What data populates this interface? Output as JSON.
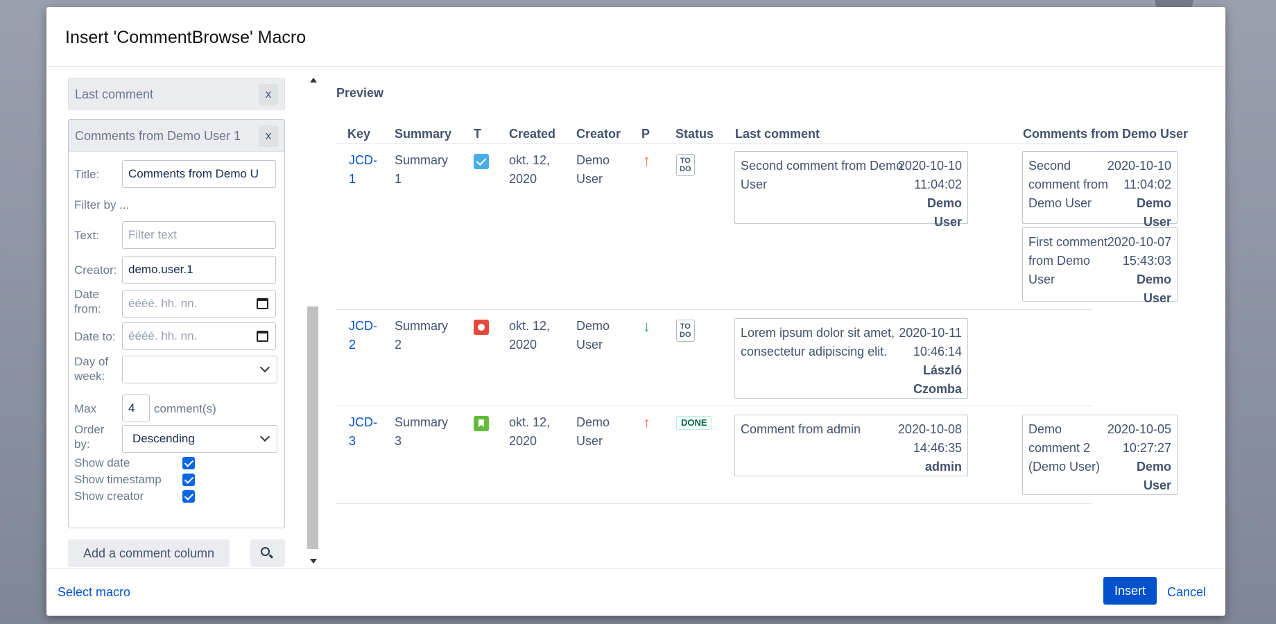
{
  "dialog": {
    "title": "Insert 'CommentBrowse' Macro",
    "footer": {
      "select_macro": "Select macro",
      "insert": "Insert",
      "cancel": "Cancel"
    }
  },
  "config": {
    "collapsed_column": {
      "title": "Last comment",
      "close": "x"
    },
    "column": {
      "title": "Comments from Demo User 1",
      "close": "x",
      "title_label": "Title:",
      "title_value": "Comments from Demo U",
      "filter_by": "Filter by ...",
      "text_label": "Text:",
      "text_placeholder": "Filter text",
      "creator_label": "Creator:",
      "creator_value": "demo.user.1",
      "date_from_label": "Date from:",
      "date_from_placeholder": "éééé. hh. nn.",
      "date_to_label": "Date to:",
      "date_to_placeholder": "éééé. hh. nn.",
      "day_of_week_label": "Day of week:",
      "day_of_week_value": "",
      "max_label": "Max",
      "max_value": "4",
      "max_suffix": "comment(s)",
      "order_by_label": "Order by:",
      "order_by_value": "Descending",
      "show_date": "Show date",
      "show_timestamp": "Show timestamp",
      "show_creator": "Show creator"
    },
    "add_column": "Add a comment column"
  },
  "preview": {
    "title": "Preview",
    "headers": {
      "key": "Key",
      "summary": "Summary",
      "t": "T",
      "created": "Created",
      "creator": "Creator",
      "p": "P",
      "status": "Status",
      "last_comment": "Last comment",
      "comments_demo": "Comments from Demo User"
    },
    "rows": [
      {
        "key_a": "JCD-",
        "key_b": "1",
        "summary_a": "Summary",
        "summary_b": "1",
        "type": "task",
        "created_a": "okt. 12,",
        "created_b": "2020",
        "creator_a": "Demo",
        "creator_b": "User",
        "priority": "↑",
        "status_a": "TO",
        "status_b": "DO",
        "last_comment": {
          "text_a": "Second comment from Demo",
          "text_b": "User",
          "date": "2020-10-10",
          "time": "11:04:02",
          "author_a": "Demo",
          "author_b": "User"
        },
        "demo_comments": [
          {
            "text_a": "Second",
            "text_b": "comment from",
            "text_c": "Demo User",
            "date": "2020-10-10",
            "time": "11:04:02",
            "author_a": "Demo",
            "author_b": "User"
          },
          {
            "text_a": "First comment",
            "text_b": "from Demo",
            "text_c": "User",
            "date": "2020-10-07",
            "time": "15:43:03",
            "author_a": "Demo",
            "author_b": "User"
          }
        ]
      },
      {
        "key_a": "JCD-",
        "key_b": "2",
        "summary_a": "Summary",
        "summary_b": "2",
        "type": "bug",
        "created_a": "okt. 12,",
        "created_b": "2020",
        "creator_a": "Demo",
        "creator_b": "User",
        "priority": "↓",
        "status_a": "TO",
        "status_b": "DO",
        "last_comment": {
          "text_a": "Lorem ipsum dolor sit amet,",
          "text_b": "consectetur adipiscing elit.",
          "date": "2020-10-11",
          "time": "10:46:14",
          "author_a": "László",
          "author_b": "Czomba"
        }
      },
      {
        "key_a": "JCD-",
        "key_b": "3",
        "summary_a": "Summary",
        "summary_b": "3",
        "type": "story",
        "created_a": "okt. 12,",
        "created_b": "2020",
        "creator_a": "Demo",
        "creator_b": "User",
        "priority": "↑",
        "status": "DONE",
        "last_comment": {
          "text_a": "Comment from admin",
          "date": "2020-10-08",
          "time": "14:46:35",
          "author_a": "admin"
        },
        "demo_comments": [
          {
            "text_a": "Demo",
            "text_b": "comment 2",
            "text_c": "(Demo User)",
            "date": "2020-10-05",
            "time": "10:27:27",
            "author_a": "Demo",
            "author_b": "User"
          }
        ]
      }
    ]
  }
}
